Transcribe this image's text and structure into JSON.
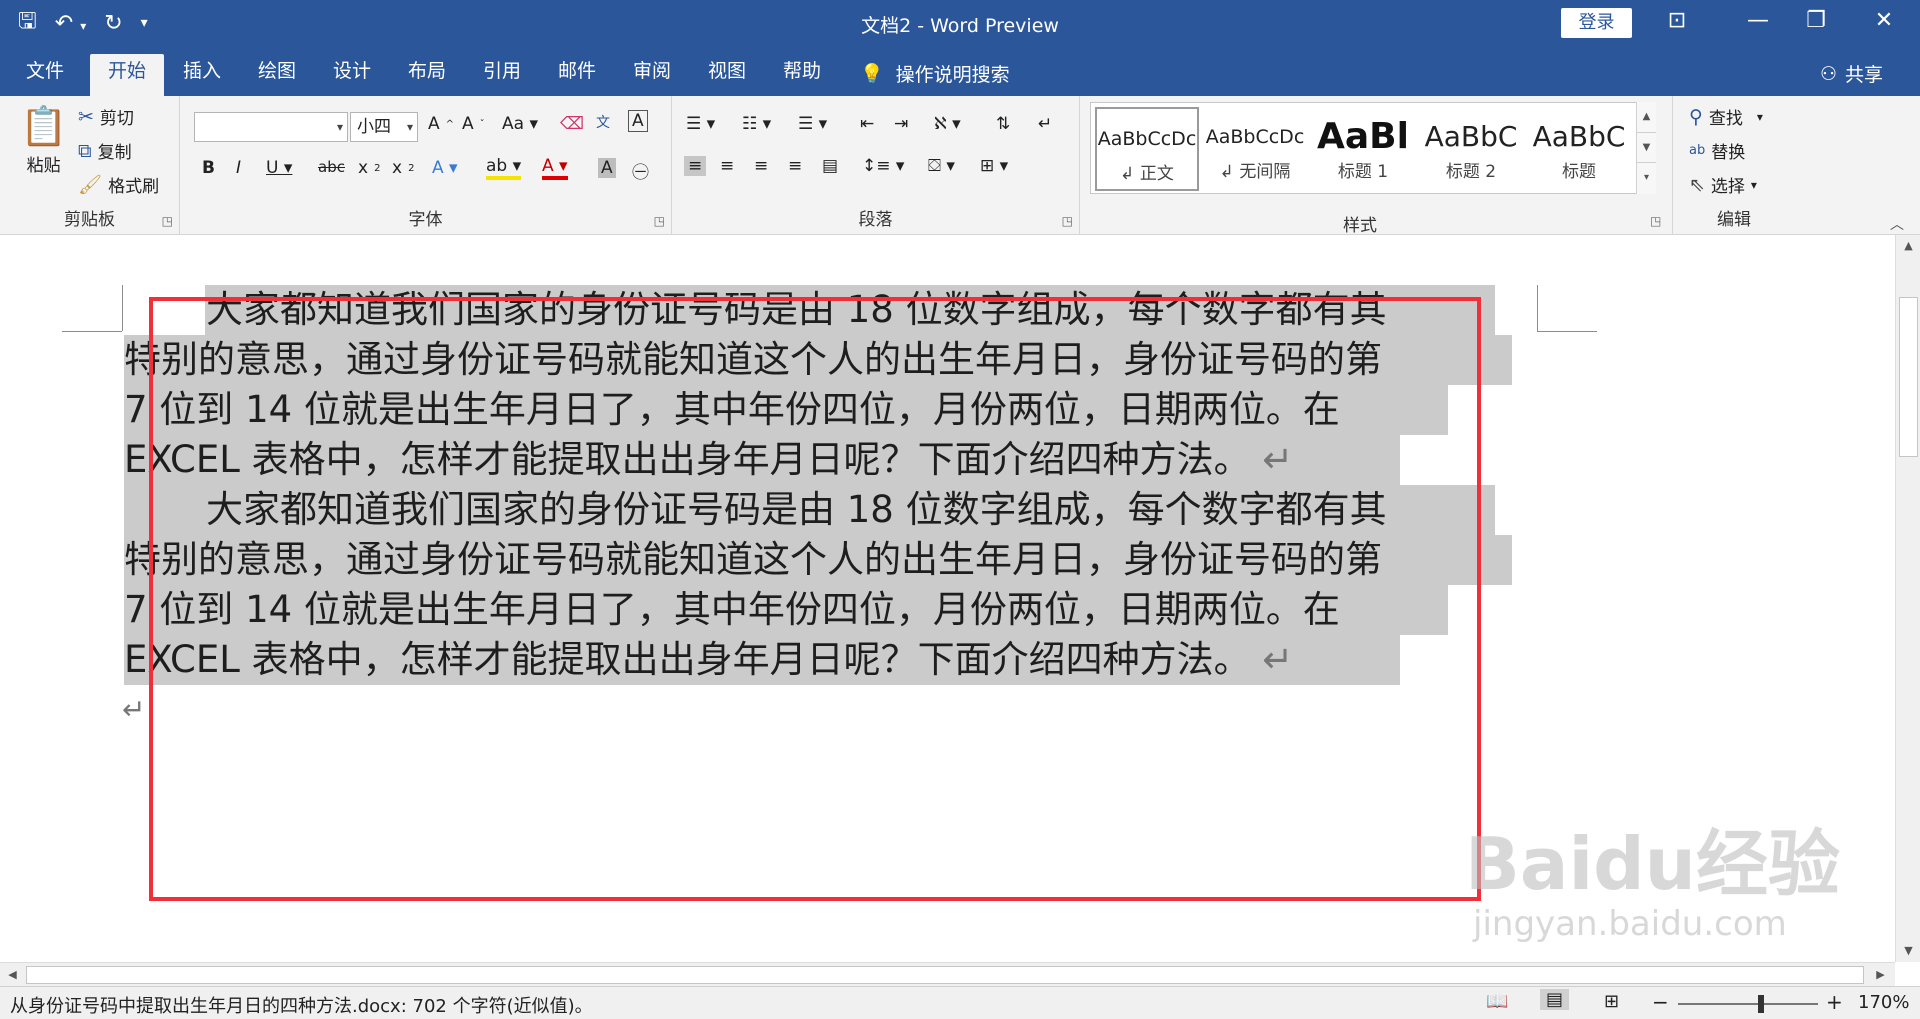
{
  "window": {
    "title": "文档2  -  Word Preview",
    "login_label": "登录"
  },
  "tabs": [
    "文件",
    "开始",
    "插入",
    "绘图",
    "设计",
    "布局",
    "引用",
    "邮件",
    "审阅",
    "视图",
    "帮助"
  ],
  "tell_me": "操作说明搜索",
  "share": "共享",
  "ribbon": {
    "clipboard": {
      "label": "剪贴板",
      "paste": "粘贴",
      "cut": "剪切",
      "copy": "复制",
      "format_painter": "格式刷"
    },
    "font": {
      "label": "字体",
      "font_name": "",
      "font_size": "小四"
    },
    "paragraph": {
      "label": "段落"
    },
    "styles": {
      "label": "样式",
      "items": [
        {
          "preview": "AaBbCcDc",
          "name": "↲ 正文"
        },
        {
          "preview": "AaBbCcDc",
          "name": "↲ 无间隔"
        },
        {
          "preview": "AaBl",
          "name": "标题 1"
        },
        {
          "preview": "AaBbC",
          "name": "标题 2"
        },
        {
          "preview": "AaBbC",
          "name": "标题"
        }
      ]
    },
    "editing": {
      "label": "编辑",
      "find": "查找",
      "replace": "替换",
      "select": "选择"
    }
  },
  "document": {
    "lines": [
      "大家都知道我们国家的身份证号码是由 18 位数字组成，每个数字都有其",
      "特别的意思，通过身份证号码就能知道这个人的出生年月日，身份证号码的第",
      "7 位到 14 位就是出生年月日了，其中年份四位，月份两位，日期两位。在",
      "EXCEL 表格中，怎样才能提取出出身年月日呢？下面介绍四种方法。",
      "大家都知道我们国家的身份证号码是由 18 位数字组成，每个数字都有其",
      "特别的意思，通过身份证号码就能知道这个人的出生年月日，身份证号码的第",
      "7 位到 14 位就是出生年月日了，其中年份四位，月份两位，日期两位。在",
      "EXCEL 表格中，怎样才能提取出出身年月日呢？下面介绍四种方法。"
    ],
    "paragraph_mark": "↵"
  },
  "watermark": {
    "brand": "Baidu经验",
    "url": "jingyan.baidu.com"
  },
  "status": {
    "text": "从身份证号码中提取出生年月日的四种方法.docx: 702 个字符(近似值)。",
    "zoom": "170%"
  },
  "colors": {
    "accent": "#2b579a",
    "highlight": "#cbcbcb",
    "annotation": "#f22e3a"
  }
}
